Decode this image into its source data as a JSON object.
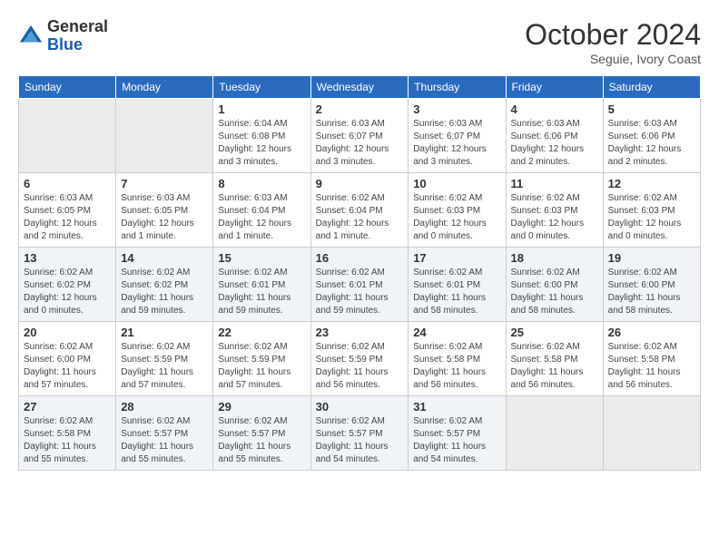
{
  "header": {
    "logo_line1": "General",
    "logo_line2": "Blue",
    "month_year": "October 2024",
    "location": "Seguie, Ivory Coast"
  },
  "days_of_week": [
    "Sunday",
    "Monday",
    "Tuesday",
    "Wednesday",
    "Thursday",
    "Friday",
    "Saturday"
  ],
  "weeks": [
    [
      {
        "day": "",
        "info": ""
      },
      {
        "day": "",
        "info": ""
      },
      {
        "day": "1",
        "info": "Sunrise: 6:04 AM\nSunset: 6:08 PM\nDaylight: 12 hours and 3 minutes."
      },
      {
        "day": "2",
        "info": "Sunrise: 6:03 AM\nSunset: 6:07 PM\nDaylight: 12 hours and 3 minutes."
      },
      {
        "day": "3",
        "info": "Sunrise: 6:03 AM\nSunset: 6:07 PM\nDaylight: 12 hours and 3 minutes."
      },
      {
        "day": "4",
        "info": "Sunrise: 6:03 AM\nSunset: 6:06 PM\nDaylight: 12 hours and 2 minutes."
      },
      {
        "day": "5",
        "info": "Sunrise: 6:03 AM\nSunset: 6:06 PM\nDaylight: 12 hours and 2 minutes."
      }
    ],
    [
      {
        "day": "6",
        "info": "Sunrise: 6:03 AM\nSunset: 6:05 PM\nDaylight: 12 hours and 2 minutes."
      },
      {
        "day": "7",
        "info": "Sunrise: 6:03 AM\nSunset: 6:05 PM\nDaylight: 12 hours and 1 minute."
      },
      {
        "day": "8",
        "info": "Sunrise: 6:03 AM\nSunset: 6:04 PM\nDaylight: 12 hours and 1 minute."
      },
      {
        "day": "9",
        "info": "Sunrise: 6:02 AM\nSunset: 6:04 PM\nDaylight: 12 hours and 1 minute."
      },
      {
        "day": "10",
        "info": "Sunrise: 6:02 AM\nSunset: 6:03 PM\nDaylight: 12 hours and 0 minutes."
      },
      {
        "day": "11",
        "info": "Sunrise: 6:02 AM\nSunset: 6:03 PM\nDaylight: 12 hours and 0 minutes."
      },
      {
        "day": "12",
        "info": "Sunrise: 6:02 AM\nSunset: 6:03 PM\nDaylight: 12 hours and 0 minutes."
      }
    ],
    [
      {
        "day": "13",
        "info": "Sunrise: 6:02 AM\nSunset: 6:02 PM\nDaylight: 12 hours and 0 minutes."
      },
      {
        "day": "14",
        "info": "Sunrise: 6:02 AM\nSunset: 6:02 PM\nDaylight: 11 hours and 59 minutes."
      },
      {
        "day": "15",
        "info": "Sunrise: 6:02 AM\nSunset: 6:01 PM\nDaylight: 11 hours and 59 minutes."
      },
      {
        "day": "16",
        "info": "Sunrise: 6:02 AM\nSunset: 6:01 PM\nDaylight: 11 hours and 59 minutes."
      },
      {
        "day": "17",
        "info": "Sunrise: 6:02 AM\nSunset: 6:01 PM\nDaylight: 11 hours and 58 minutes."
      },
      {
        "day": "18",
        "info": "Sunrise: 6:02 AM\nSunset: 6:00 PM\nDaylight: 11 hours and 58 minutes."
      },
      {
        "day": "19",
        "info": "Sunrise: 6:02 AM\nSunset: 6:00 PM\nDaylight: 11 hours and 58 minutes."
      }
    ],
    [
      {
        "day": "20",
        "info": "Sunrise: 6:02 AM\nSunset: 6:00 PM\nDaylight: 11 hours and 57 minutes."
      },
      {
        "day": "21",
        "info": "Sunrise: 6:02 AM\nSunset: 5:59 PM\nDaylight: 11 hours and 57 minutes."
      },
      {
        "day": "22",
        "info": "Sunrise: 6:02 AM\nSunset: 5:59 PM\nDaylight: 11 hours and 57 minutes."
      },
      {
        "day": "23",
        "info": "Sunrise: 6:02 AM\nSunset: 5:59 PM\nDaylight: 11 hours and 56 minutes."
      },
      {
        "day": "24",
        "info": "Sunrise: 6:02 AM\nSunset: 5:58 PM\nDaylight: 11 hours and 56 minutes."
      },
      {
        "day": "25",
        "info": "Sunrise: 6:02 AM\nSunset: 5:58 PM\nDaylight: 11 hours and 56 minutes."
      },
      {
        "day": "26",
        "info": "Sunrise: 6:02 AM\nSunset: 5:58 PM\nDaylight: 11 hours and 56 minutes."
      }
    ],
    [
      {
        "day": "27",
        "info": "Sunrise: 6:02 AM\nSunset: 5:58 PM\nDaylight: 11 hours and 55 minutes."
      },
      {
        "day": "28",
        "info": "Sunrise: 6:02 AM\nSunset: 5:57 PM\nDaylight: 11 hours and 55 minutes."
      },
      {
        "day": "29",
        "info": "Sunrise: 6:02 AM\nSunset: 5:57 PM\nDaylight: 11 hours and 55 minutes."
      },
      {
        "day": "30",
        "info": "Sunrise: 6:02 AM\nSunset: 5:57 PM\nDaylight: 11 hours and 54 minutes."
      },
      {
        "day": "31",
        "info": "Sunrise: 6:02 AM\nSunset: 5:57 PM\nDaylight: 11 hours and 54 minutes."
      },
      {
        "day": "",
        "info": ""
      },
      {
        "day": "",
        "info": ""
      }
    ]
  ]
}
